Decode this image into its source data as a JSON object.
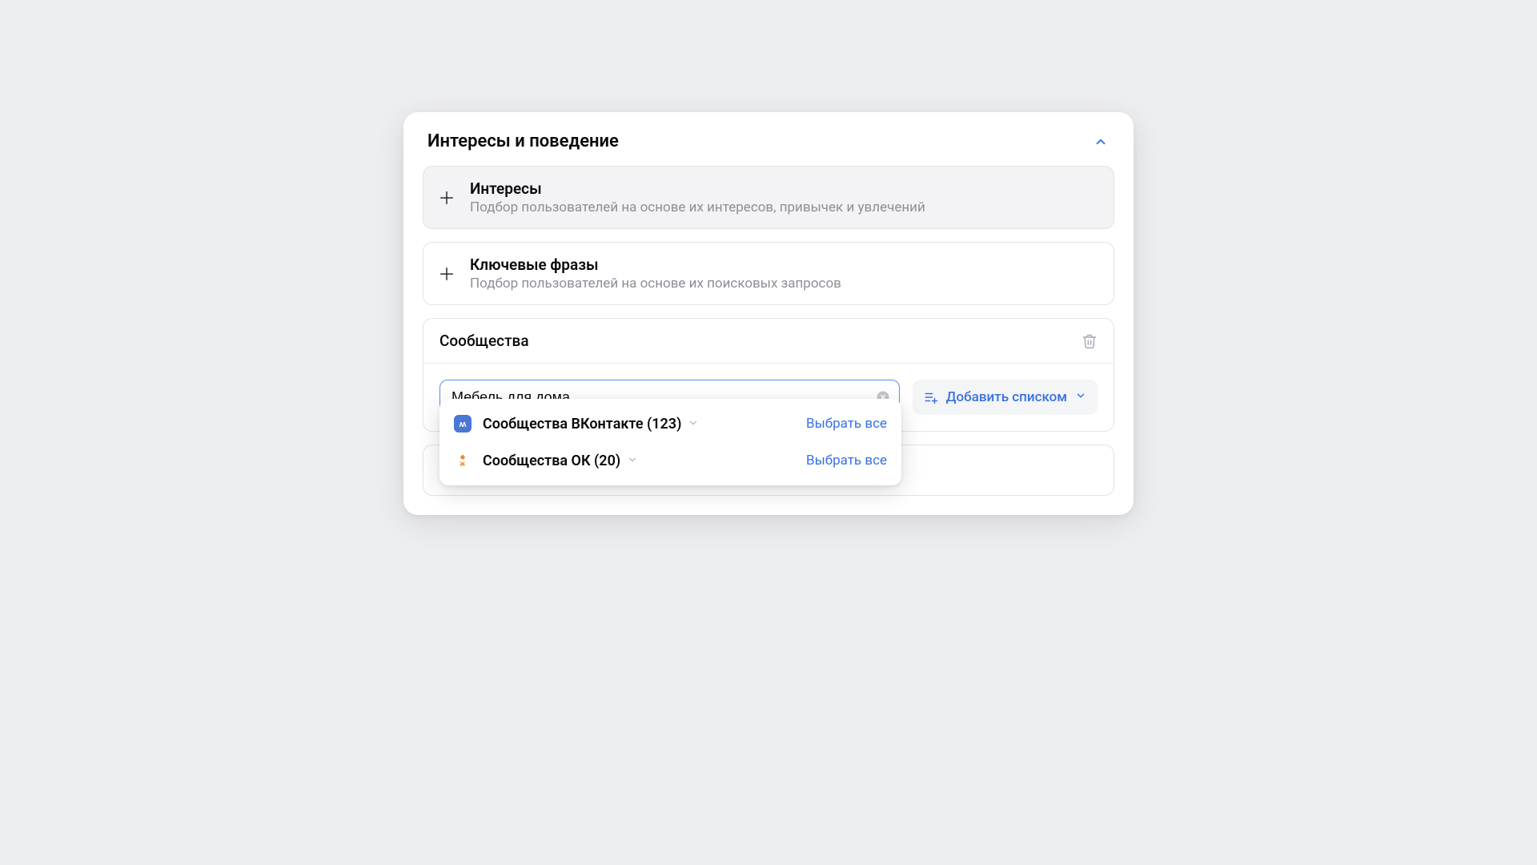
{
  "panel": {
    "title": "Интересы и поведение"
  },
  "cards": {
    "interests": {
      "title": "Интересы",
      "desc": "Подбор пользователей на основе их интересов, привычек и увлечений"
    },
    "keywords": {
      "title": "Ключевые фразы",
      "desc": "Подбор пользователей на основе их поисковых запросов"
    }
  },
  "communities": {
    "title": "Сообщества",
    "search_value": "Мебель для дома",
    "add_list_label": "Добавить списком"
  },
  "dropdown": {
    "vk": {
      "label": "Сообщества ВКонтакте (123)",
      "select_all": "Выбрать все",
      "badge": "ʍ"
    },
    "ok": {
      "label": "Сообщества ОК (20)",
      "select_all": "Выбрать все"
    }
  }
}
